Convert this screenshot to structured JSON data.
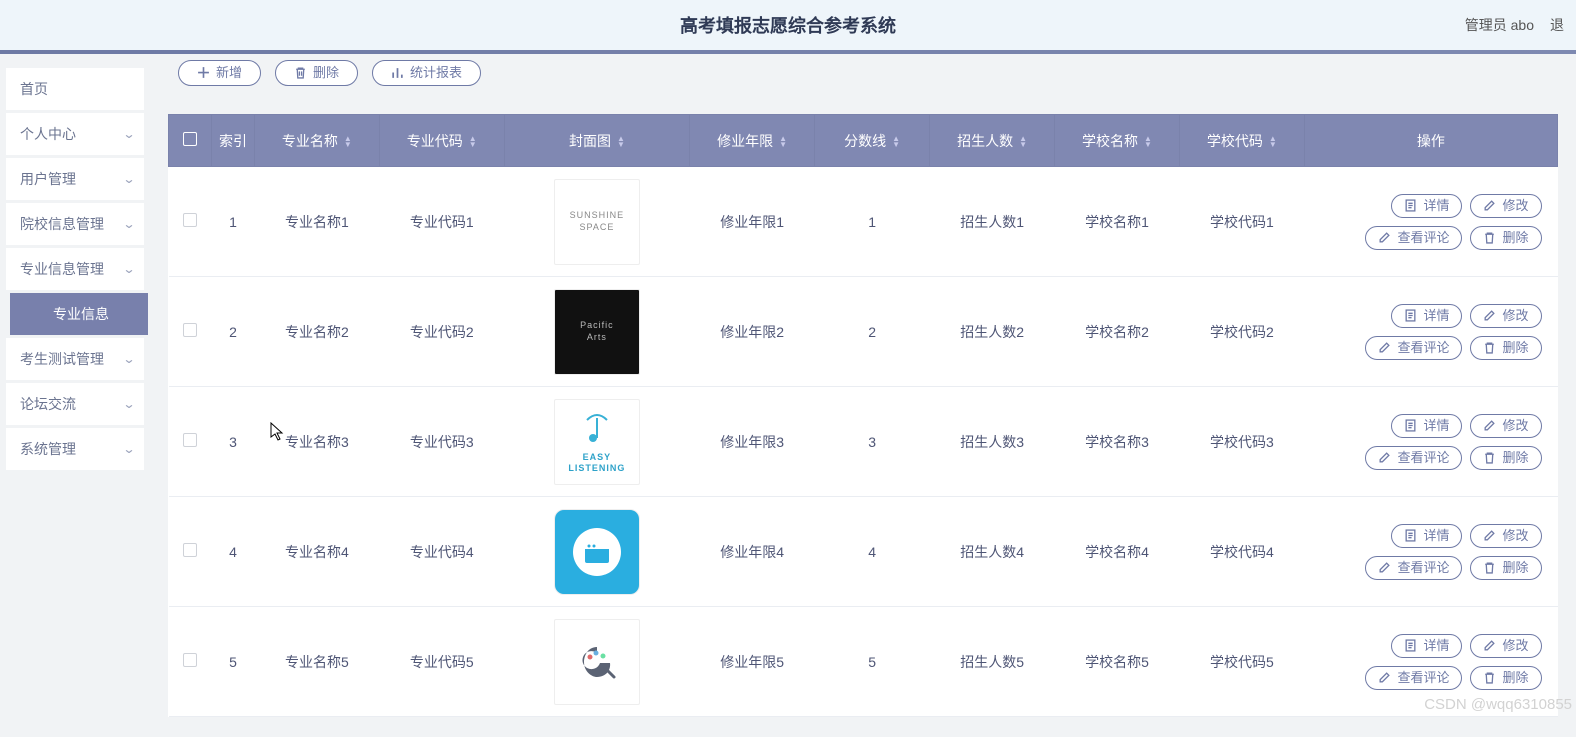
{
  "banner": {
    "title": "高考填报志愿综合参考系统",
    "user_label": "管理员 abo",
    "logout_label": "退"
  },
  "sidebar": {
    "items": [
      {
        "label": "首页",
        "arrow": false,
        "active": false
      },
      {
        "label": "个人中心",
        "arrow": true,
        "active": false
      },
      {
        "label": "用户管理",
        "arrow": true,
        "active": false
      },
      {
        "label": "院校信息管理",
        "arrow": true,
        "active": false
      },
      {
        "label": "专业信息管理",
        "arrow": true,
        "active": false
      },
      {
        "label": "专业信息",
        "arrow": false,
        "active": true
      },
      {
        "label": "考生测试管理",
        "arrow": true,
        "active": false
      },
      {
        "label": "论坛交流",
        "arrow": true,
        "active": false
      },
      {
        "label": "系统管理",
        "arrow": true,
        "active": false
      }
    ]
  },
  "toolbar": {
    "add_label": "新增",
    "delete_label": "删除",
    "report_label": "统计报表"
  },
  "table": {
    "headers": {
      "index": "索引",
      "major": "专业名称",
      "code": "专业代码",
      "cover": "封面图",
      "years": "修业年限",
      "score": "分数线",
      "enroll": "招生人数",
      "school": "学校名称",
      "school_code": "学校代码",
      "ops": "操作"
    },
    "op_labels": {
      "detail": "详情",
      "edit": "修改",
      "review": "查看评论",
      "delete": "删除"
    },
    "rows": [
      {
        "idx": "1",
        "major": "专业名称1",
        "code": "专业代码1",
        "cover": "SUNSHINE SPACE",
        "cover_variant": "light",
        "years": "修业年限1",
        "score": "1",
        "enroll": "招生人数1",
        "school": "学校名称1",
        "school_code": "学校代码1"
      },
      {
        "idx": "2",
        "major": "专业名称2",
        "code": "专业代码2",
        "cover": "Pacific Arts",
        "cover_variant": "dark",
        "years": "修业年限2",
        "score": "2",
        "enroll": "招生人数2",
        "school": "学校名称2",
        "school_code": "学校代码2"
      },
      {
        "idx": "3",
        "major": "专业名称3",
        "code": "专业代码3",
        "cover": "EASY LISTENING",
        "cover_variant": "light",
        "years": "修业年限3",
        "score": "3",
        "enroll": "招生人数3",
        "school": "学校名称3",
        "school_code": "学校代码3"
      },
      {
        "idx": "4",
        "major": "专业名称4",
        "code": "专业代码4",
        "cover": "",
        "cover_variant": "blue",
        "years": "修业年限4",
        "score": "4",
        "enroll": "招生人数4",
        "school": "学校名称4",
        "school_code": "学校代码4"
      },
      {
        "idx": "5",
        "major": "专业名称5",
        "code": "专业代码5",
        "cover": "",
        "cover_variant": "light",
        "years": "修业年限5",
        "score": "5",
        "enroll": "招生人数5",
        "school": "学校名称5",
        "school_code": "学校代码5"
      }
    ]
  },
  "watermark": "CSDN @wqq6310855"
}
